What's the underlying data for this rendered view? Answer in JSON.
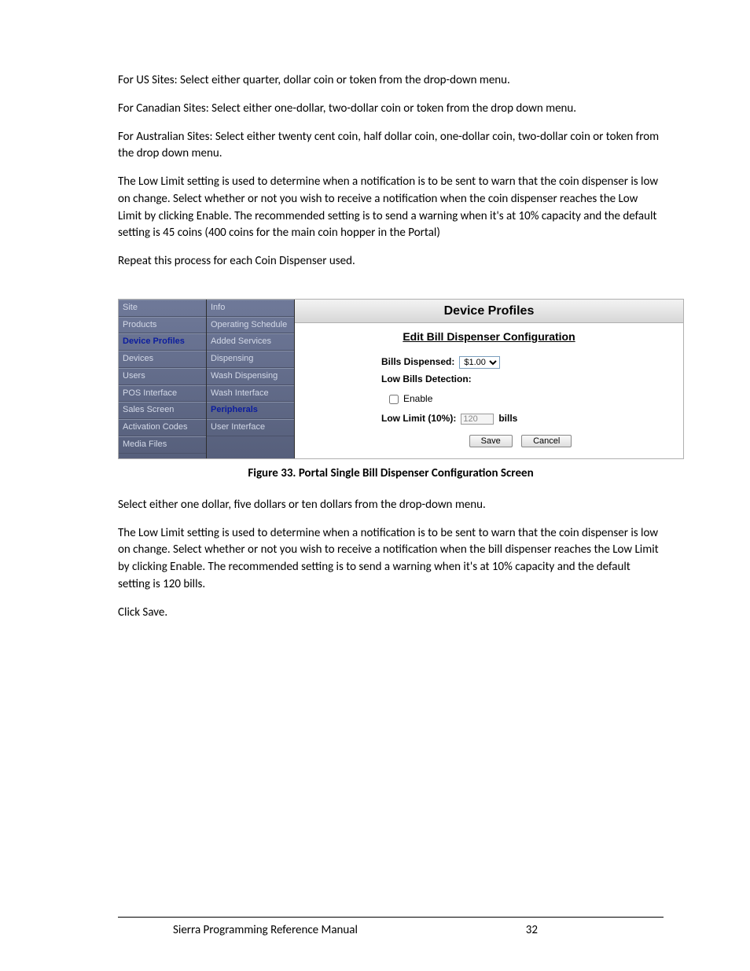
{
  "body": {
    "p1": "For US Sites: Select either quarter, dollar coin or token from the drop-down menu.",
    "p2": "For Canadian Sites: Select either one-dollar, two-dollar coin or token from the drop down menu.",
    "p3": "For Australian Sites: Select either twenty cent coin, half dollar coin, one-dollar coin, two-dollar coin or token from the drop down menu.",
    "p4": "The Low Limit setting is used to determine when a notification is to be sent to warn that the coin dispenser is low on change. Select whether or not you wish to receive a notification when the coin dispenser reaches the Low Limit by clicking Enable. The recommended setting is to send a warning when it's at 10% capacity and the default setting is 45 coins (400 coins for the main coin hopper in the Portal)",
    "p5": "Repeat this process for each Coin Dispenser used.",
    "p6": "Select either one dollar, five dollars or ten dollars from the drop-down menu.",
    "p7": "The Low Limit setting is used to determine when a notification is to be sent to warn that the coin dispenser is low on change. Select whether or not you wish to receive a notification when the bill dispenser reaches the Low Limit by clicking Enable. The recommended setting is to send a warning when it's at 10% capacity and the default setting is 120 bills.",
    "p8": "Click Save."
  },
  "figure": {
    "nav1": [
      "Site",
      "Products",
      "Device Profiles",
      "Devices",
      "Users",
      "POS Interface",
      "Sales Screen",
      "Activation Codes",
      "Media Files"
    ],
    "nav1_active_index": 2,
    "nav2": [
      "Info",
      "Operating Schedule",
      "Added Services",
      "Dispensing",
      "Wash Dispensing",
      "Wash Interface",
      "Peripherals",
      "User Interface"
    ],
    "nav2_active_index": 6,
    "title": "Device Profiles",
    "subtitle": "Edit Bill Dispenser Configuration",
    "form": {
      "bills_label": "Bills Dispensed:",
      "bills_value": "$1.00",
      "low_bills_detection": "Low Bills Detection:",
      "enable_label": "Enable",
      "low_limit_label": "Low Limit (10%):",
      "low_limit_value": "120",
      "low_limit_unit": "bills",
      "save": "Save",
      "cancel": "Cancel"
    }
  },
  "caption": "Figure 33. Portal Single Bill Dispenser Configuration Screen",
  "footer": {
    "title": "Sierra Programming Reference Manual",
    "page": "32"
  }
}
